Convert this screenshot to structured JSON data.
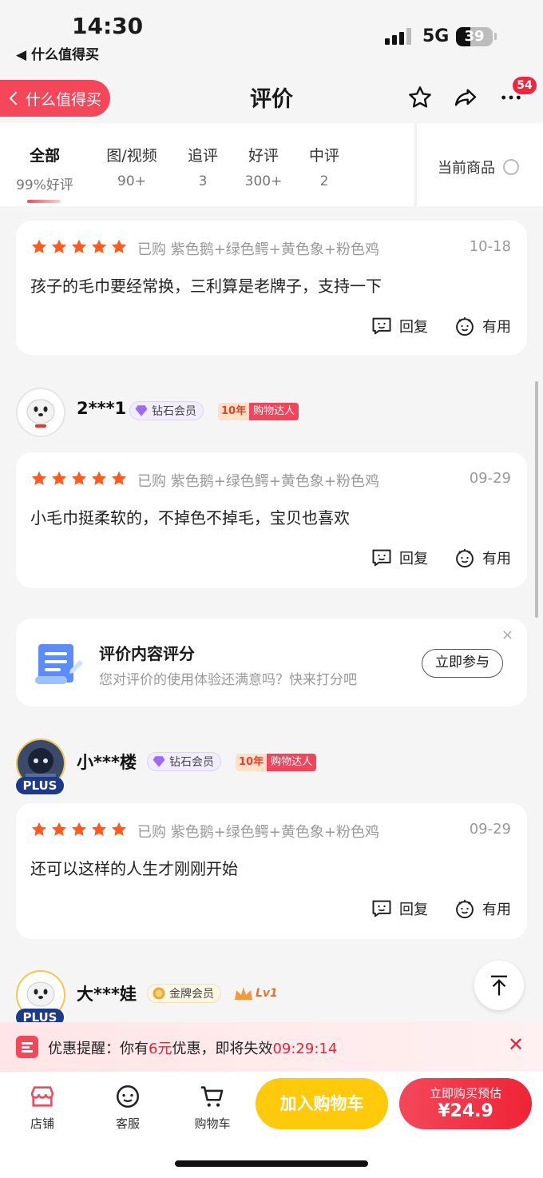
{
  "status_bar": {
    "time": "14:30",
    "back_app": "◀ 什么值得买",
    "network": "5G",
    "battery": "39"
  },
  "nav": {
    "back_label": "什么值得买",
    "title": "评价",
    "more_badge": "54"
  },
  "tabs": [
    {
      "label": "全部",
      "count": "99%好评"
    },
    {
      "label": "图/视频",
      "count": "90+"
    },
    {
      "label": "追评",
      "count": "3"
    },
    {
      "label": "好评",
      "count": "300+"
    },
    {
      "label": "中评",
      "count": "2"
    }
  ],
  "current_goods_label": "当前商品",
  "reviews": [
    {
      "purchased": "已购 紫色鹅+绿色鳄+黄色象+粉色鸡",
      "date": "10-18",
      "text": "孩子的毛巾要经常换，三利算是老牌子，支持一下",
      "reply": "回复",
      "useful": "有用"
    },
    {
      "user": "2***1",
      "member": "钻石会员",
      "years": "10年",
      "years_tag": "购物达人",
      "purchased": "已购 紫色鹅+绿色鳄+黄色象+粉色鸡",
      "date": "09-29",
      "text": "小毛巾挺柔软的，不掉色不掉毛，宝贝也喜欢",
      "reply": "回复",
      "useful": "有用"
    },
    {
      "user": "小***楼",
      "plus": "PLUS",
      "member": "钻石会员",
      "years": "10年",
      "years_tag": "购物达人",
      "purchased": "已购 紫色鹅+绿色鳄+黄色象+粉色鸡",
      "date": "09-29",
      "text": "还可以这样的人生才刚刚开始",
      "reply": "回复",
      "useful": "有用"
    },
    {
      "user": "大***娃",
      "plus": "PLUS",
      "member": "金牌会员",
      "level_badge": "Lv1"
    }
  ],
  "survey": {
    "title": "评价内容评分",
    "subtitle": "您对评价的使用体验还满意吗？快来打分吧",
    "button": "立即参与",
    "close": "×"
  },
  "promo": {
    "prefix": "优惠提醒：你有",
    "amount": "6元",
    "middle": "优惠，即将失效",
    "countdown": "09:29:14",
    "close": "✕"
  },
  "bottom_bar": {
    "shop": "店铺",
    "service": "客服",
    "cart": "购物车",
    "add_to_cart": "加入购物车",
    "buy_now_label": "立即购买预估",
    "buy_now_price": "¥24.9"
  },
  "colors": {
    "accent": "#f4475a",
    "star": "#ff5a1f",
    "cart_button": "#ffc90c"
  }
}
